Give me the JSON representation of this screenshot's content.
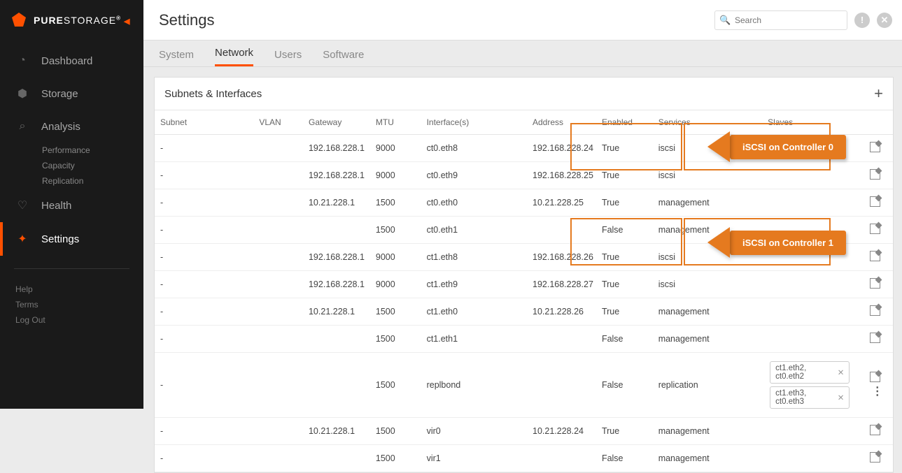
{
  "brand": {
    "bold": "PURE",
    "light": "STORAGE",
    "caret": "◀"
  },
  "nav": {
    "dashboard": "Dashboard",
    "storage": "Storage",
    "analysis": "Analysis",
    "analysis_sub": [
      "Performance",
      "Capacity",
      "Replication"
    ],
    "health": "Health",
    "settings": "Settings"
  },
  "footer": {
    "help": "Help",
    "terms": "Terms",
    "logout": "Log Out"
  },
  "page_title": "Settings",
  "search_placeholder": "Search",
  "tabs": {
    "system": "System",
    "network": "Network",
    "users": "Users",
    "software": "Software"
  },
  "panel_title": "Subnets & Interfaces",
  "cols": {
    "subnet": "Subnet",
    "vlan": "VLAN",
    "gateway": "Gateway",
    "mtu": "MTU",
    "iface": "Interface(s)",
    "address": "Address",
    "enabled": "Enabled",
    "services": "Services",
    "slaves": "Slaves"
  },
  "rows": [
    {
      "subnet": "-",
      "vlan": "",
      "gateway": "192.168.228.1",
      "mtu": "9000",
      "iface": "ct0.eth8",
      "address": "192.168.228.24",
      "enabled": "True",
      "services": "iscsi",
      "slaves": []
    },
    {
      "subnet": "-",
      "vlan": "",
      "gateway": "192.168.228.1",
      "mtu": "9000",
      "iface": "ct0.eth9",
      "address": "192.168.228.25",
      "enabled": "True",
      "services": "iscsi",
      "slaves": []
    },
    {
      "subnet": "-",
      "vlan": "",
      "gateway": "10.21.228.1",
      "mtu": "1500",
      "iface": "ct0.eth0",
      "address": "10.21.228.25",
      "enabled": "True",
      "services": "management",
      "slaves": []
    },
    {
      "subnet": "-",
      "vlan": "",
      "gateway": "",
      "mtu": "1500",
      "iface": "ct0.eth1",
      "address": "",
      "enabled": "False",
      "services": "management",
      "slaves": []
    },
    {
      "subnet": "-",
      "vlan": "",
      "gateway": "192.168.228.1",
      "mtu": "9000",
      "iface": "ct1.eth8",
      "address": "192.168.228.26",
      "enabled": "True",
      "services": "iscsi",
      "slaves": []
    },
    {
      "subnet": "-",
      "vlan": "",
      "gateway": "192.168.228.1",
      "mtu": "9000",
      "iface": "ct1.eth9",
      "address": "192.168.228.27",
      "enabled": "True",
      "services": "iscsi",
      "slaves": []
    },
    {
      "subnet": "-",
      "vlan": "",
      "gateway": "10.21.228.1",
      "mtu": "1500",
      "iface": "ct1.eth0",
      "address": "10.21.228.26",
      "enabled": "True",
      "services": "management",
      "slaves": []
    },
    {
      "subnet": "-",
      "vlan": "",
      "gateway": "",
      "mtu": "1500",
      "iface": "ct1.eth1",
      "address": "",
      "enabled": "False",
      "services": "management",
      "slaves": []
    },
    {
      "subnet": "-",
      "vlan": "",
      "gateway": "",
      "mtu": "1500",
      "iface": "replbond",
      "address": "",
      "enabled": "False",
      "services": "replication",
      "slaves": [
        "ct1.eth2, ct0.eth2",
        "ct1.eth3, ct0.eth3"
      ],
      "more": true
    },
    {
      "subnet": "-",
      "vlan": "",
      "gateway": "10.21.228.1",
      "mtu": "1500",
      "iface": "vir0",
      "address": "10.21.228.24",
      "enabled": "True",
      "services": "management",
      "slaves": []
    },
    {
      "subnet": "-",
      "vlan": "",
      "gateway": "",
      "mtu": "1500",
      "iface": "vir1",
      "address": "",
      "enabled": "False",
      "services": "management",
      "slaves": []
    }
  ],
  "annot": {
    "c0": "iSCSI on Controller 0",
    "c1": "iSCSI on Controller 1"
  }
}
